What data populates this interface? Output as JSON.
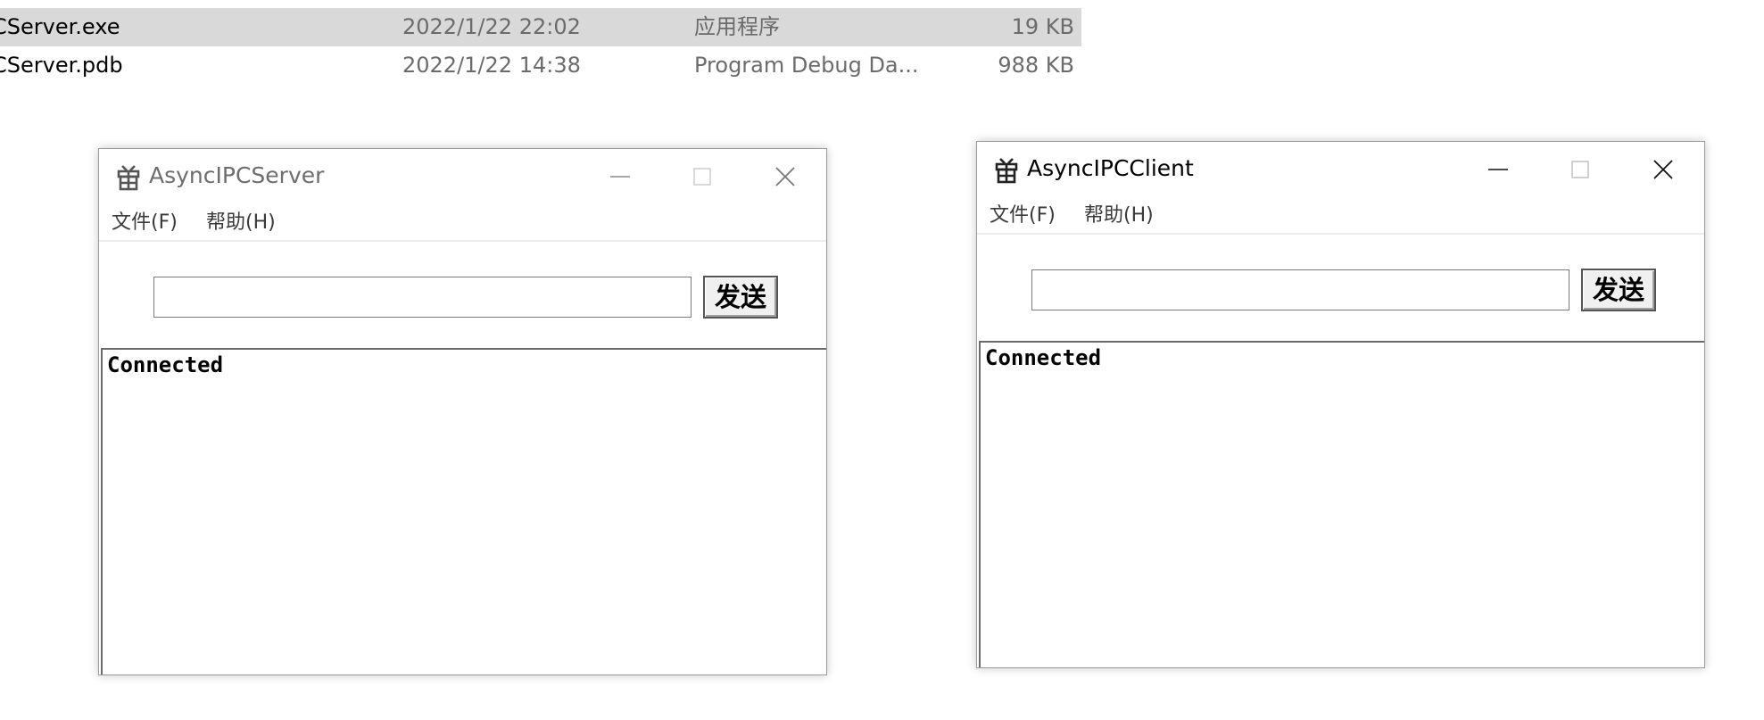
{
  "explorer": {
    "files": [
      {
        "name": "CServer.exe",
        "date": "2022/1/22 22:02",
        "type": "应用程序",
        "size": "19 KB",
        "selected": true
      },
      {
        "name": "CServer.pdb",
        "date": "2022/1/22 14:38",
        "type": "Program Debug Da...",
        "size": "988 KB",
        "selected": false
      }
    ]
  },
  "server_window": {
    "title": "AsyncIPCServer",
    "menu": {
      "file": "文件(F)",
      "help": "帮助(H)"
    },
    "input_value": "",
    "send_label": "发送",
    "log": [
      "Connected"
    ]
  },
  "client_window": {
    "title": "AsyncIPCClient",
    "menu": {
      "file": "文件(F)",
      "help": "帮助(H)"
    },
    "input_value": "",
    "send_label": "发送",
    "log": [
      "Connected"
    ]
  },
  "colors": {
    "selected_row": "#d9d9d9",
    "inactive_title": "#6d6d6d",
    "active_title": "#000000"
  },
  "icons": {
    "app": "gift-box-icon",
    "minimize": "minimize-icon",
    "maximize": "maximize-icon",
    "close": "close-icon"
  }
}
